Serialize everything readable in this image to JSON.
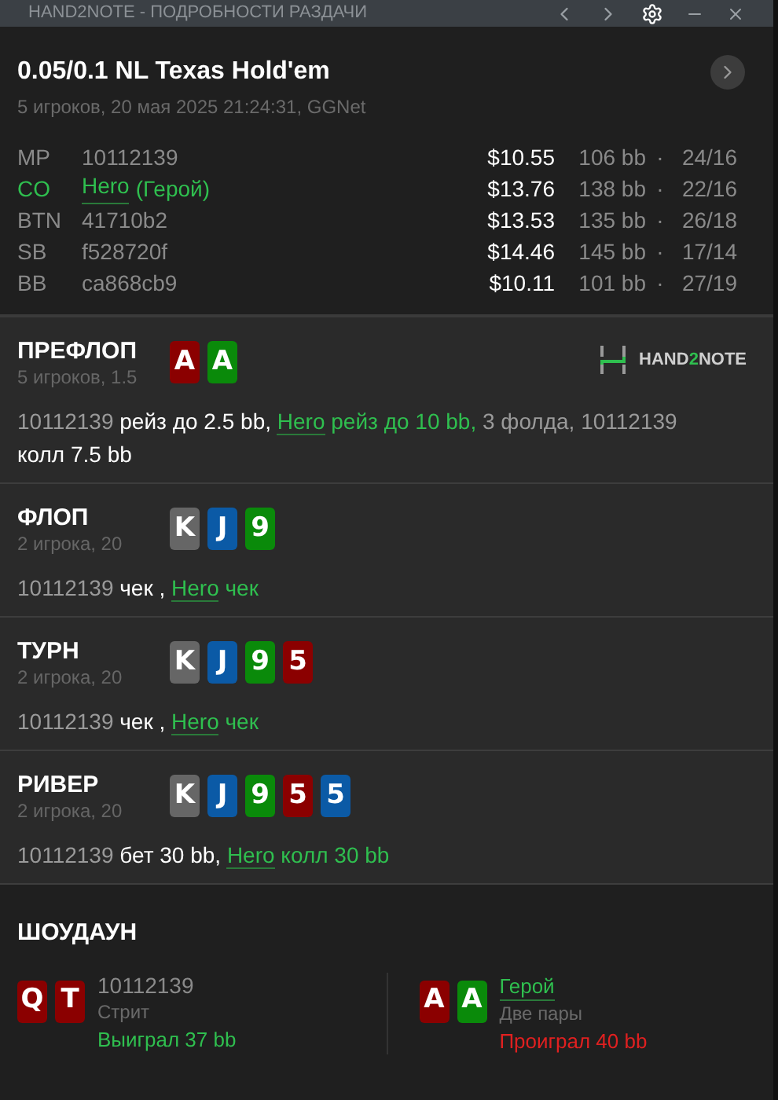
{
  "window": {
    "title": "HAND2NOTE - ПОДРОБНОСТИ РАЗДАЧИ"
  },
  "header": {
    "title": "0.05/0.1 NL Texas Hold'em",
    "subtitle": "5 игроков, 20 мая 2025 21:24:31, GGNet"
  },
  "players": [
    {
      "position": "MP",
      "name": "10112139",
      "hero": false,
      "money": "$10.55",
      "stack": "106 bb",
      "sep": "·",
      "stats": "24/16"
    },
    {
      "position": "CO",
      "name": "Hero",
      "note": "(Герой)",
      "hero": true,
      "money": "$13.76",
      "stack": "138 bb",
      "sep": "·",
      "stats": "22/16"
    },
    {
      "position": "BTN",
      "name": "41710b2",
      "hero": false,
      "money": "$13.53",
      "stack": "135 bb",
      "sep": "·",
      "stats": "26/18"
    },
    {
      "position": "SB",
      "name": "f528720f",
      "hero": false,
      "money": "$14.46",
      "stack": "145 bb",
      "sep": "·",
      "stats": "17/14"
    },
    {
      "position": "BB",
      "name": "ca868cb9",
      "hero": false,
      "money": "$10.11",
      "stack": "101 bb",
      "sep": "·",
      "stats": "27/19"
    }
  ],
  "streets": [
    {
      "name": "ПРЕФЛОП",
      "info": "5 игроков, 1.5",
      "logo": {
        "parts": [
          {
            "text": "HAND",
            "accent": false
          },
          {
            "text": "2",
            "accent": true
          },
          {
            "text": "NOTE",
            "accent": false
          }
        ]
      },
      "cards": [
        {
          "rank": "A",
          "color": "#8b0000"
        },
        {
          "rank": "A",
          "color": "#0a8a0a"
        }
      ],
      "actions": [
        {
          "kind": "player",
          "text": "10112139"
        },
        {
          "kind": "action",
          "text": " рейз до 2.5 bb, "
        },
        {
          "kind": "hero",
          "text": "Hero"
        },
        {
          "kind": "hero_action",
          "text": " рейз до 10 bb,"
        },
        {
          "kind": "player",
          "text": " 3 фолда, 10112139"
        },
        {
          "kind": "action",
          "text": " колл 7.5 bb"
        }
      ]
    },
    {
      "name": "ФЛОП",
      "info": "2 игрока, 20",
      "cards": [
        {
          "rank": "K",
          "color": "#666666"
        },
        {
          "rank": "J",
          "color": "#0b5aa6"
        },
        {
          "rank": "9",
          "color": "#0a8a0a"
        }
      ],
      "actions": [
        {
          "kind": "player",
          "text": "10112139"
        },
        {
          "kind": "action",
          "text": " чек , "
        },
        {
          "kind": "hero",
          "text": "Hero"
        },
        {
          "kind": "hero_action",
          "text": " чек"
        }
      ]
    },
    {
      "name": "ТУРН",
      "info": "2 игрока, 20",
      "cards": [
        {
          "rank": "K",
          "color": "#666666"
        },
        {
          "rank": "J",
          "color": "#0b5aa6"
        },
        {
          "rank": "9",
          "color": "#0a8a0a"
        },
        {
          "rank": "5",
          "color": "#8b0000"
        }
      ],
      "actions": [
        {
          "kind": "player",
          "text": "10112139"
        },
        {
          "kind": "action",
          "text": " чек , "
        },
        {
          "kind": "hero",
          "text": "Hero"
        },
        {
          "kind": "hero_action",
          "text": " чек"
        }
      ]
    },
    {
      "name": "РИВЕР",
      "info": "2 игрока, 20",
      "cards": [
        {
          "rank": "K",
          "color": "#666666"
        },
        {
          "rank": "J",
          "color": "#0b5aa6"
        },
        {
          "rank": "9",
          "color": "#0a8a0a"
        },
        {
          "rank": "5",
          "color": "#8b0000"
        },
        {
          "rank": "5",
          "color": "#0b5aa6"
        }
      ],
      "actions": [
        {
          "kind": "player",
          "text": "10112139"
        },
        {
          "kind": "action",
          "text": " бет 30 bb, "
        },
        {
          "kind": "hero",
          "text": "Hero"
        },
        {
          "kind": "hero_action",
          "text": " колл 30 bb"
        }
      ]
    }
  ],
  "showdown": {
    "title": "ШОУДАУН",
    "players": [
      {
        "name": "10112139",
        "hero": false,
        "hand": "Стрит",
        "result": "Выиграл 37 bb",
        "won": true,
        "cards": [
          {
            "rank": "Q",
            "color": "#8b0000"
          },
          {
            "rank": "T",
            "color": "#8b0000"
          }
        ]
      },
      {
        "name": "Герой",
        "hero": true,
        "hand": "Две пары",
        "result": "Проиграл 40 bb",
        "won": false,
        "cards": [
          {
            "rank": "A",
            "color": "#8b0000"
          },
          {
            "rank": "A",
            "color": "#0a8a0a"
          }
        ]
      }
    ]
  }
}
